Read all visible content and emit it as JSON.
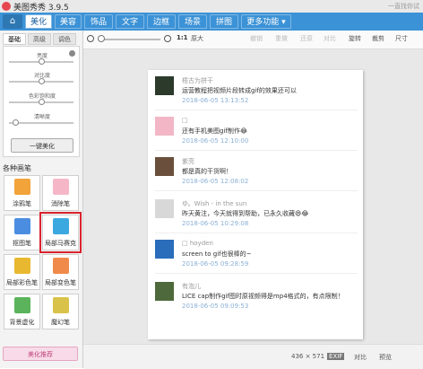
{
  "app": {
    "title": "美图秀秀 3.9.5",
    "title_right": "一直找你试"
  },
  "menu": {
    "home": "⌂",
    "tabs": [
      "美化",
      "美容",
      "饰品",
      "文字",
      "边框",
      "场景",
      "拼图",
      "更多功能 ▾"
    ]
  },
  "left_panel": {
    "subtabs": [
      "基础",
      "高级",
      "调色"
    ],
    "sliders": [
      {
        "label": "亮度",
        "value": 0.5
      },
      {
        "label": "对比度",
        "value": 0.5
      },
      {
        "label": "色彩饱和度",
        "value": 0.5
      },
      {
        "label": "清晰度",
        "value": 0.1
      }
    ],
    "one_key_button": "一键美化",
    "brush_heading": "各种画笔",
    "tools": [
      "涂鸦笔",
      "消除笔",
      "抠图笔",
      "局部马赛克",
      "局部彩色笔",
      "局部变色笔",
      "背景虚化",
      "魔幻笔"
    ],
    "beauty_recommend": "美化推荐",
    "tool_colors": [
      "#f2a33a",
      "#f5b7c8",
      "#4b8de0",
      "#3ca8e0",
      "#e8b830",
      "#f08a4b",
      "#5bb35b",
      "#d9c24a"
    ]
  },
  "toolbar": {
    "ratio": "1:1",
    "original": "原大",
    "undo": "撤销",
    "redo": "重做",
    "reset": "还原",
    "compare": "对比",
    "rotate": "旋转",
    "crop": "裁剪",
    "resize": "尺寸"
  },
  "comments": [
    {
      "name": "梧古为拼干",
      "text": "运营教程把视频片段转成gif的效果还可以",
      "time": "2018-06-05 13:13:52",
      "avatar_color": "#2c3a2c"
    },
    {
      "name": "□",
      "text": "还有手机美图gif制作😂",
      "time": "2018-06-05 12:10:00",
      "avatar_color": "#f2b6c6"
    },
    {
      "name": "紫亮",
      "text": "都是真的干货啊！",
      "time": "2018-06-05 12:08:02",
      "avatar_color": "#6a4f3c"
    },
    {
      "name": "ゆ。Wish - in the sun",
      "text": "昨天黄注，今天就得到帮助，已永久收藏😄😂",
      "time": "2018-06-05 10:29:08",
      "avatar_color": "#d8d8d8"
    },
    {
      "name": "□ hoyden",
      "text": "screen to gif也很棒的~",
      "time": "2018-06-05 09:28:59",
      "avatar_color": "#2a6dbb"
    },
    {
      "name": "有泡儿",
      "text": "LICE cap制作gif图时原视频得是mp4格式的，有点限制！",
      "time": "2018-06-05 09:09:53",
      "avatar_color": "#4e6a3c"
    }
  ],
  "status": {
    "dimensions": "436 × 571",
    "exif": "EXIF",
    "compare": "对比",
    "preview": "预览"
  }
}
